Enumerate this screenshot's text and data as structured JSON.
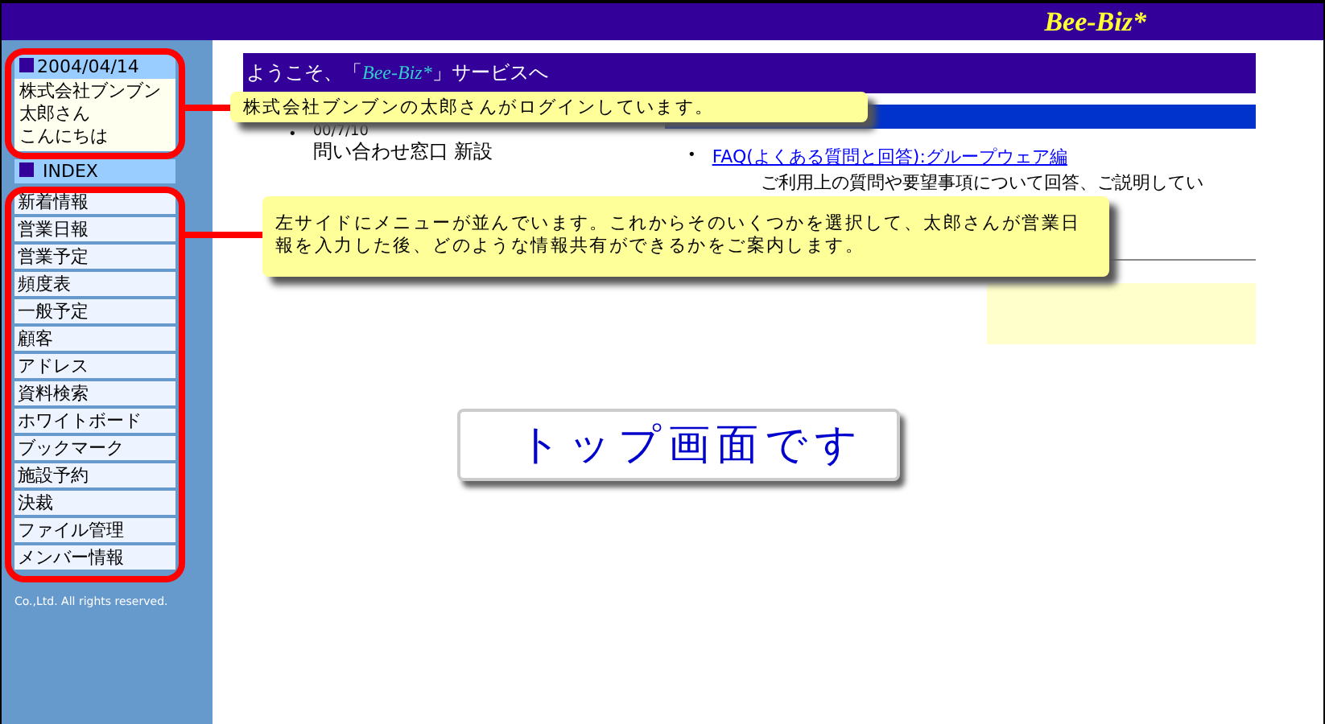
{
  "header": {
    "logo": "Bee-Biz*"
  },
  "sidebar": {
    "date": "2004/04/14",
    "user_lines": [
      "株式会社ブンブン",
      "太郎さん",
      "こんにちは"
    ],
    "index_label": "INDEX",
    "menu": [
      "新着情報",
      "営業日報",
      "営業予定",
      "頻度表",
      "一般予定",
      "顧客",
      "アドレス",
      "資料検索",
      "ホワイトボード",
      "ブックマーク",
      "施設予約",
      "決裁",
      "ファイル管理",
      "メンバー情報"
    ],
    "copyright": "Co.,Ltd. All rights reserved."
  },
  "welcome": {
    "prefix": "ようこそ、「",
    "brand": "Bee-Biz*",
    "suffix": "」サービスへ"
  },
  "news": [
    {
      "bullet": "•",
      "date": "00/7/10",
      "title": "問い合わせ窓口 新設"
    }
  ],
  "topics": [
    {
      "bullet": "•",
      "link": "FAQ(よくある質問と回答):グループウェア編",
      "description": "ご利用上の質問や要望事項について回答、ご説明してい"
    }
  ],
  "callouts": [
    {
      "kind": "login",
      "text": "株式会社ブンブンの太郎さんがログインしています。"
    },
    {
      "kind": "menu",
      "text": "左サイドにメニューが並んでいます。これからそのいくつかを選択して、太郎さんが営業日報を入力した後、どのような情報共有ができるかをご案内します。"
    }
  ],
  "banner": "トップ画面です"
}
